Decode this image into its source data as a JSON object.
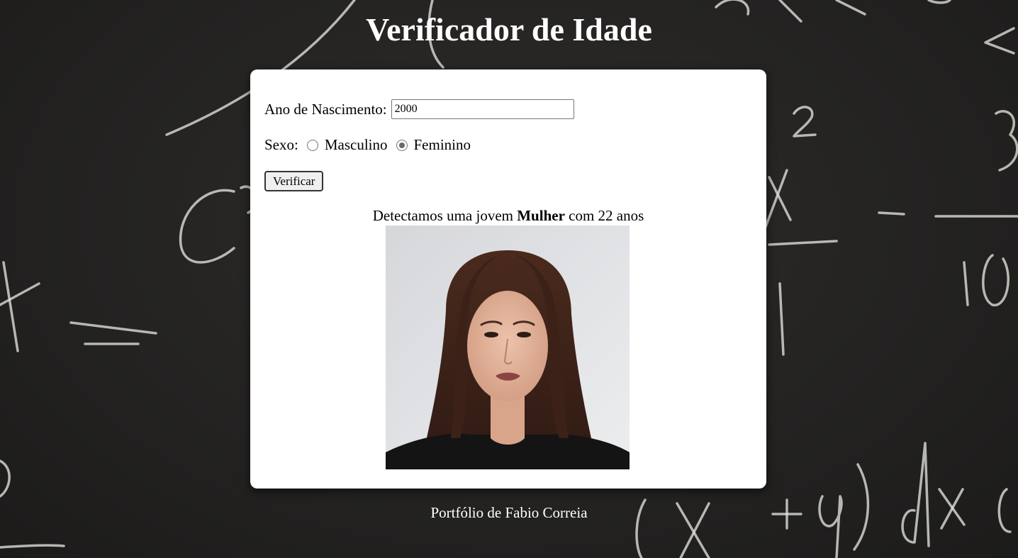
{
  "page": {
    "title": "Verificador de Idade",
    "footer": "Portfólio de Fabio Correia"
  },
  "form": {
    "year_label": "Ano de Nascimento:",
    "year_value": "2000",
    "sex_label": "Sexo:",
    "options": [
      {
        "label": "Masculino",
        "checked": false
      },
      {
        "label": "Feminino",
        "checked": true
      }
    ],
    "verify_label": "Verificar"
  },
  "result": {
    "prefix": "Detectamos uma jovem",
    "gender": "Mulher",
    "suffix": "com 22 anos"
  },
  "colors": {
    "background": "#252423",
    "card": "#ffffff",
    "title": "#ffffff",
    "chalk": "#e1e1dc"
  },
  "icons": {
    "radio_unchecked": "radio-unchecked-icon",
    "radio_checked": "radio-checked-icon",
    "photo": "young-woman-portrait"
  }
}
